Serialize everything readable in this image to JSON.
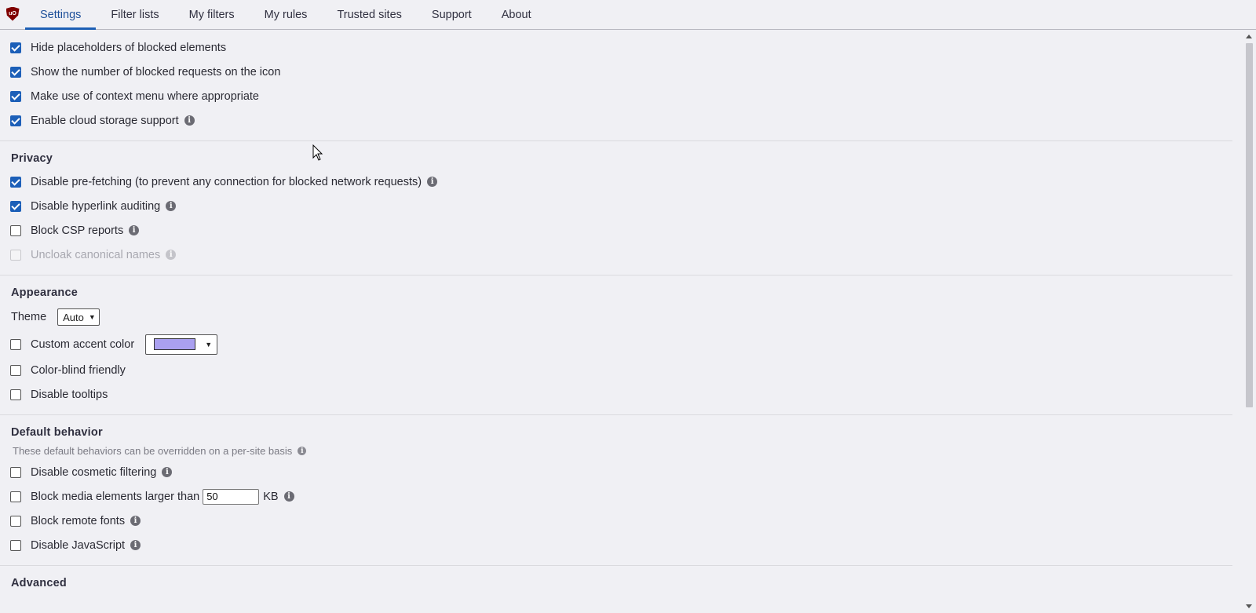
{
  "tabs": [
    {
      "label": "Settings"
    },
    {
      "label": "Filter lists"
    },
    {
      "label": "My filters"
    },
    {
      "label": "My rules"
    },
    {
      "label": "Trusted sites"
    },
    {
      "label": "Support"
    },
    {
      "label": "About"
    }
  ],
  "logo_text": "uO",
  "general": {
    "items": [
      {
        "label": "Hide placeholders of blocked elements",
        "checked": true
      },
      {
        "label": "Show the number of blocked requests on the icon",
        "checked": true
      },
      {
        "label": "Make use of context menu where appropriate",
        "checked": true
      },
      {
        "label": "Enable cloud storage support",
        "checked": true
      }
    ]
  },
  "privacy": {
    "title": "Privacy",
    "items": [
      {
        "label": "Disable pre-fetching (to prevent any connection for blocked network requests)",
        "checked": true
      },
      {
        "label": "Disable hyperlink auditing",
        "checked": true
      },
      {
        "label": "Block CSP reports",
        "checked": false
      },
      {
        "label": "Uncloak canonical names",
        "checked": false,
        "disabled": true
      }
    ]
  },
  "appearance": {
    "title": "Appearance",
    "theme_label": "Theme",
    "theme_value": "Auto",
    "accent_label": "Custom accent color",
    "accent_color": "#aaa0f0",
    "colorblind_label": "Color-blind friendly",
    "tooltips_label": "Disable tooltips"
  },
  "default_behavior": {
    "title": "Default behavior",
    "note": "These default behaviors can be overridden on a per-site basis",
    "cosmetic_label": "Disable cosmetic filtering",
    "media_label": "Block media elements larger than",
    "media_value": "50",
    "media_unit": "KB",
    "fonts_label": "Block remote fonts",
    "js_label": "Disable JavaScript"
  },
  "advanced": {
    "title": "Advanced"
  },
  "colors": {
    "accent": "#1c5fb8",
    "logo": "#800000"
  }
}
